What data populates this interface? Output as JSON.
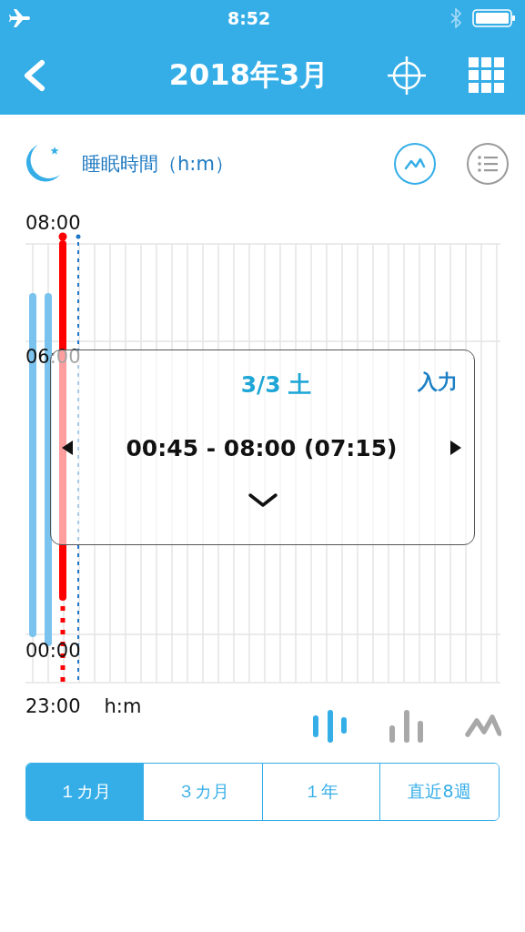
{
  "status_bar": {
    "time": "8:52"
  },
  "nav": {
    "title": "2018年3月"
  },
  "section": {
    "title": "睡眠時間（h:m）"
  },
  "view_toggle": [
    {
      "kind": "chart",
      "selected": true
    },
    {
      "kind": "list",
      "selected": false
    }
  ],
  "chart": {
    "y_labels": [
      "08:00",
      "06:00",
      "00:00"
    ],
    "axis_start": "23:00",
    "unit": "h:m"
  },
  "popup": {
    "date": "3/3 土",
    "action": "入力",
    "range": "00:45 - 08:00 (07:15)"
  },
  "chart_styles": [
    {
      "kind": "bars",
      "selected": true
    },
    {
      "kind": "columns",
      "selected": false
    },
    {
      "kind": "line",
      "selected": false
    }
  ],
  "periods": [
    {
      "label": "１カ月",
      "selected": true
    },
    {
      "label": "３カ月",
      "selected": false
    },
    {
      "label": "１年",
      "selected": false
    },
    {
      "label": "直近8週",
      "selected": false
    }
  ]
}
